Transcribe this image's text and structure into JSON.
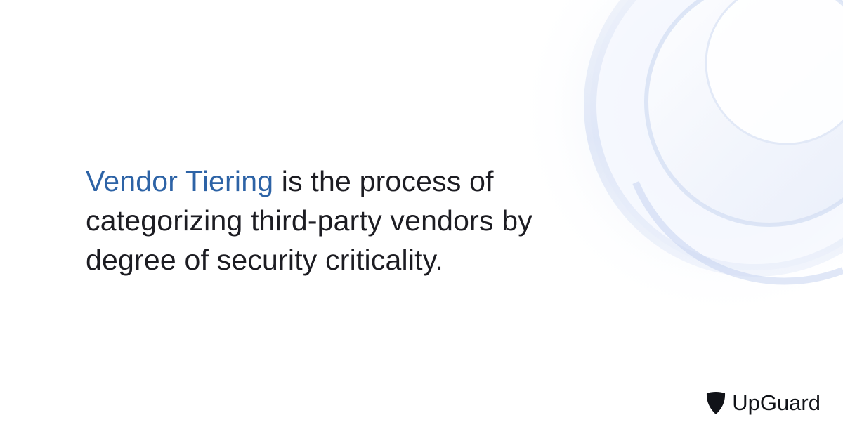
{
  "headline": {
    "highlight": "Vendor Tiering",
    "line1_rest": " is the process of",
    "line2": "categorizing third-party vendors by",
    "line3": "degree of security criticality."
  },
  "brand": {
    "name": "UpGuard",
    "icon": "upguard-shield-icon",
    "text_color": "#111318"
  },
  "colors": {
    "accent": "#2d63a6",
    "text": "#1c1c22",
    "background": "#ffffff"
  }
}
